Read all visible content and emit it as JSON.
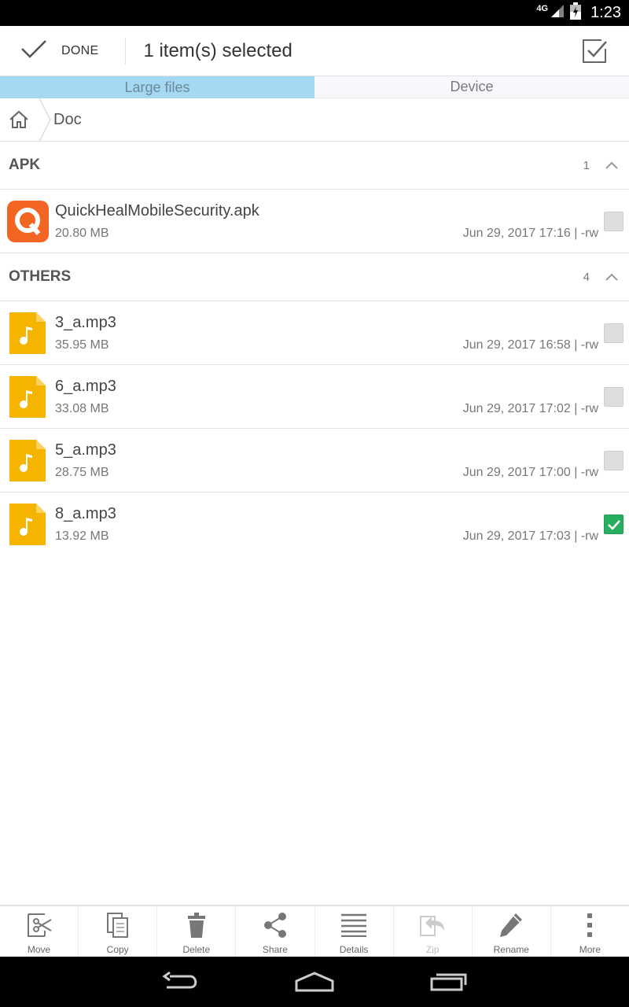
{
  "status_bar": {
    "network": "4G",
    "time": "1:23"
  },
  "action_bar": {
    "done_label": "DONE",
    "title": "1 item(s) selected"
  },
  "tabs": [
    {
      "label": "Large files",
      "active": true
    },
    {
      "label": "Device",
      "active": false
    }
  ],
  "breadcrumb": {
    "current": "Doc"
  },
  "sections": [
    {
      "title": "APK",
      "count": "1",
      "items": [
        {
          "name": "QuickHealMobileSecurity.apk",
          "size": "20.80 MB",
          "meta": "Jun 29, 2017 17:16 | -rw",
          "icon": "quickheal-app-icon",
          "checked": false
        }
      ]
    },
    {
      "title": "OTHERS",
      "count": "4",
      "items": [
        {
          "name": "3_a.mp3",
          "size": "35.95 MB",
          "meta": "Jun 29, 2017 16:58 | -rw",
          "icon": "music-file-icon",
          "checked": false
        },
        {
          "name": "6_a.mp3",
          "size": "33.08 MB",
          "meta": "Jun 29, 2017 17:02 | -rw",
          "icon": "music-file-icon",
          "checked": false
        },
        {
          "name": "5_a.mp3",
          "size": "28.75 MB",
          "meta": "Jun 29, 2017 17:00 | -rw",
          "icon": "music-file-icon",
          "checked": false
        },
        {
          "name": "8_a.mp3",
          "size": "13.92 MB",
          "meta": "Jun 29, 2017 17:03 | -rw",
          "icon": "music-file-icon",
          "checked": true
        }
      ]
    }
  ],
  "toolbar": {
    "move": "Move",
    "copy": "Copy",
    "delete": "Delete",
    "share": "Share",
    "details": "Details",
    "zip": "Zip",
    "rename": "Rename",
    "more": "More"
  },
  "colors": {
    "tab_active_bg": "#a5d8f3",
    "checkbox_checked": "#27ae60",
    "music_icon": "#f5b400",
    "quickheal_icon": "#f26522"
  }
}
